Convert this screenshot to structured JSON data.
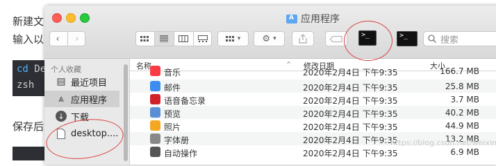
{
  "blog": {
    "line1": "新建文",
    "line2": "输入以",
    "code_l1_kw": "cd",
    "code_l1_rest": " De",
    "code_l2": "zsh",
    "line3": "保存后"
  },
  "window": {
    "title": "应用程序",
    "search_placeholder": "搜索"
  },
  "sidebar": {
    "heading": "个人收藏",
    "items": [
      {
        "label": "最近项目",
        "icon": "clock-list-icon"
      },
      {
        "label": "应用程序",
        "icon": "applications-icon"
      },
      {
        "label": "下载",
        "icon": "download-icon"
      },
      {
        "label": "desktop....",
        "icon": "document-icon"
      }
    ]
  },
  "columns": {
    "name": "名称",
    "date": "修改日期",
    "size": "大小"
  },
  "files": [
    {
      "name": "音乐",
      "date": "2020年2月4日 下午9:35",
      "size": "166.7 MB",
      "icon": "music-icon",
      "color": "#fc3c44"
    },
    {
      "name": "邮件",
      "date": "2020年2月4日 下午9:35",
      "size": "25.8 MB",
      "icon": "mail-icon",
      "color": "#3b8ef0"
    },
    {
      "name": "语音备忘录",
      "date": "2020年2月4日 下午9:35",
      "size": "3.7 MB",
      "icon": "voice-memos-icon",
      "color": "#d0212b"
    },
    {
      "name": "预览",
      "date": "2020年2月4日 下午9:35",
      "size": "40.2 MB",
      "icon": "preview-icon",
      "color": "#5a8fd6"
    },
    {
      "name": "照片",
      "date": "2020年2月4日 下午9:35",
      "size": "44.9 MB",
      "icon": "photos-icon",
      "color": "#f5a623"
    },
    {
      "name": "字体册",
      "date": "2020年2月4日 下午9:35",
      "size": "13.2 MB",
      "icon": "font-book-icon",
      "color": "#888888"
    },
    {
      "name": "自动操作",
      "date": "2020年2月4日 下午9:35",
      "size": "6.9 MB",
      "icon": "automator-icon",
      "color": "#555555"
    }
  ],
  "watermark": "https://blog.csdn.net/weixin_"
}
